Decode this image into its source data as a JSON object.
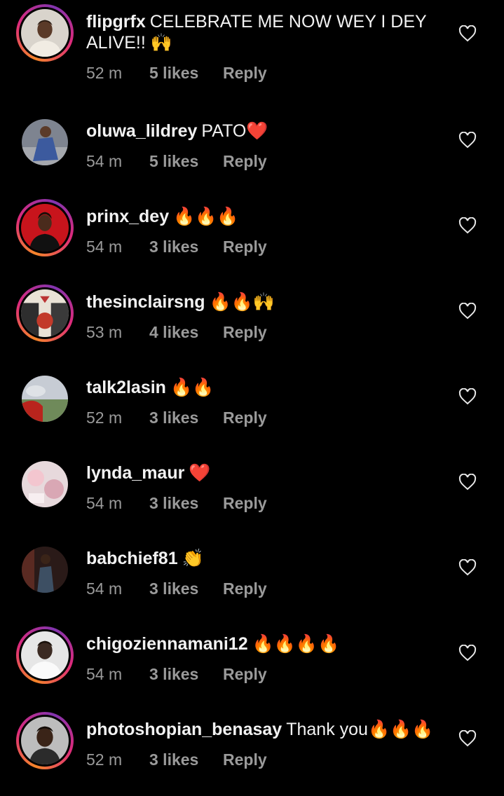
{
  "comments": [
    {
      "username": "flipgrfx",
      "text": "CELEBRATE ME NOW WEY I DEY ALIVE!! 🙌",
      "time": "52 m",
      "likes": "5 likes",
      "reply": "Reply",
      "avatar": "avatar-man-white-hoodie",
      "story_ring": true
    },
    {
      "username": "oluwa_lildrey",
      "text": "PATO❤️",
      "time": "54 m",
      "likes": "5 likes",
      "reply": "Reply",
      "avatar": "avatar-man-patterned-shirt",
      "story_ring": false
    },
    {
      "username": "prinx_dey",
      "text": "🔥🔥🔥",
      "time": "54 m",
      "likes": "3 likes",
      "reply": "Reply",
      "avatar": "avatar-man-red-background",
      "story_ring": true
    },
    {
      "username": "thesinclairsng",
      "text": "🔥🔥🙌",
      "time": "53 m",
      "likes": "4 likes",
      "reply": "Reply",
      "avatar": "avatar-event-flyer",
      "story_ring": true
    },
    {
      "username": "talk2lasin",
      "text": "🔥🔥",
      "time": "52 m",
      "likes": "3 likes",
      "reply": "Reply",
      "avatar": "avatar-landscape-cap",
      "story_ring": false
    },
    {
      "username": "lynda_maur",
      "text": "❤️",
      "time": "54 m",
      "likes": "3 likes",
      "reply": "Reply",
      "avatar": "avatar-pink-decor",
      "story_ring": false
    },
    {
      "username": "babchief81",
      "text": "👏",
      "time": "54 m",
      "likes": "3 likes",
      "reply": "Reply",
      "avatar": "avatar-man-dark-room",
      "story_ring": false
    },
    {
      "username": "chigoziennamani12",
      "text": "🔥🔥🔥🔥",
      "time": "54 m",
      "likes": "3 likes",
      "reply": "Reply",
      "avatar": "avatar-man-white-shirt",
      "story_ring": true
    },
    {
      "username": "photoshopian_benasay",
      "text": "Thank you🔥🔥🔥",
      "time": "52 m",
      "likes": "3 likes",
      "reply": "Reply",
      "avatar": "avatar-man-portrait",
      "story_ring": true
    }
  ],
  "icons": {
    "like": "heart-outline-icon"
  },
  "colors": {
    "background": "#000000",
    "text": "#f2f2f2",
    "meta": "#9a9a9a",
    "ring_start": "#f58529",
    "ring_end": "#dd2a7b"
  }
}
